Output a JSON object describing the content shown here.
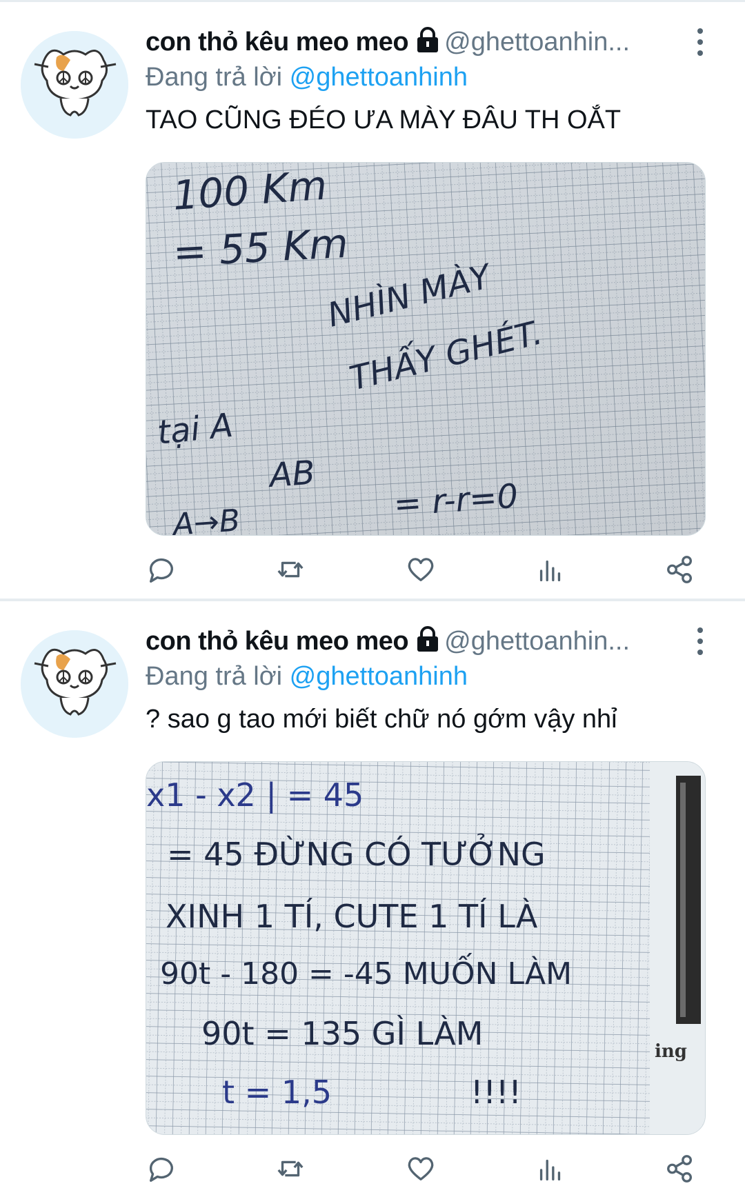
{
  "tweets": [
    {
      "display_name": "con thỏ kêu meo meo",
      "handle": "@ghettoanhin...",
      "reply_prefix": "Đang trả lời",
      "reply_mention": "@ghettoanhinh",
      "text": "TAO CŨNG ĐÉO ƯA MÀY ĐÂU TH OẮT",
      "photo_handwriting": [
        "100 Km",
        "= 55 Km",
        "NHÌN MÀY",
        "THẤY GHÉT.",
        "tại A",
        "AB",
        "A→B",
        "= r-r=0"
      ]
    },
    {
      "display_name": "con thỏ kêu meo meo",
      "handle": "@ghettoanhin...",
      "reply_prefix": "Đang trả lời",
      "reply_mention": "@ghettoanhinh",
      "text": "? sao g tao mới biết chữ nó gớm vậy nhỉ",
      "photo_handwriting": [
        "x1 - x2 | = 45",
        "= 45 ĐỪNG CÓ TƯỞNG",
        "XINH 1 TÍ, CUTE 1 TÍ LÀ",
        "90t - 180 = -45 MUỐN LÀM",
        "90t = 135 GÌ LÀM",
        "t = 1,5",
        "!!!!",
        "ing"
      ]
    }
  ],
  "icons": {
    "avatar": "hamster-avatar",
    "lock": "lock-icon",
    "more": "more-vertical-icon",
    "actions": [
      "reply-icon",
      "retweet-icon",
      "like-icon",
      "analytics-icon",
      "share-icon"
    ]
  },
  "colors": {
    "text": "#0f1419",
    "secondary": "#657786",
    "link": "#1da1f2",
    "avatar_bg": "#e4f3fb",
    "paper": "#dfe7ee",
    "ink": "#1f2a44"
  }
}
